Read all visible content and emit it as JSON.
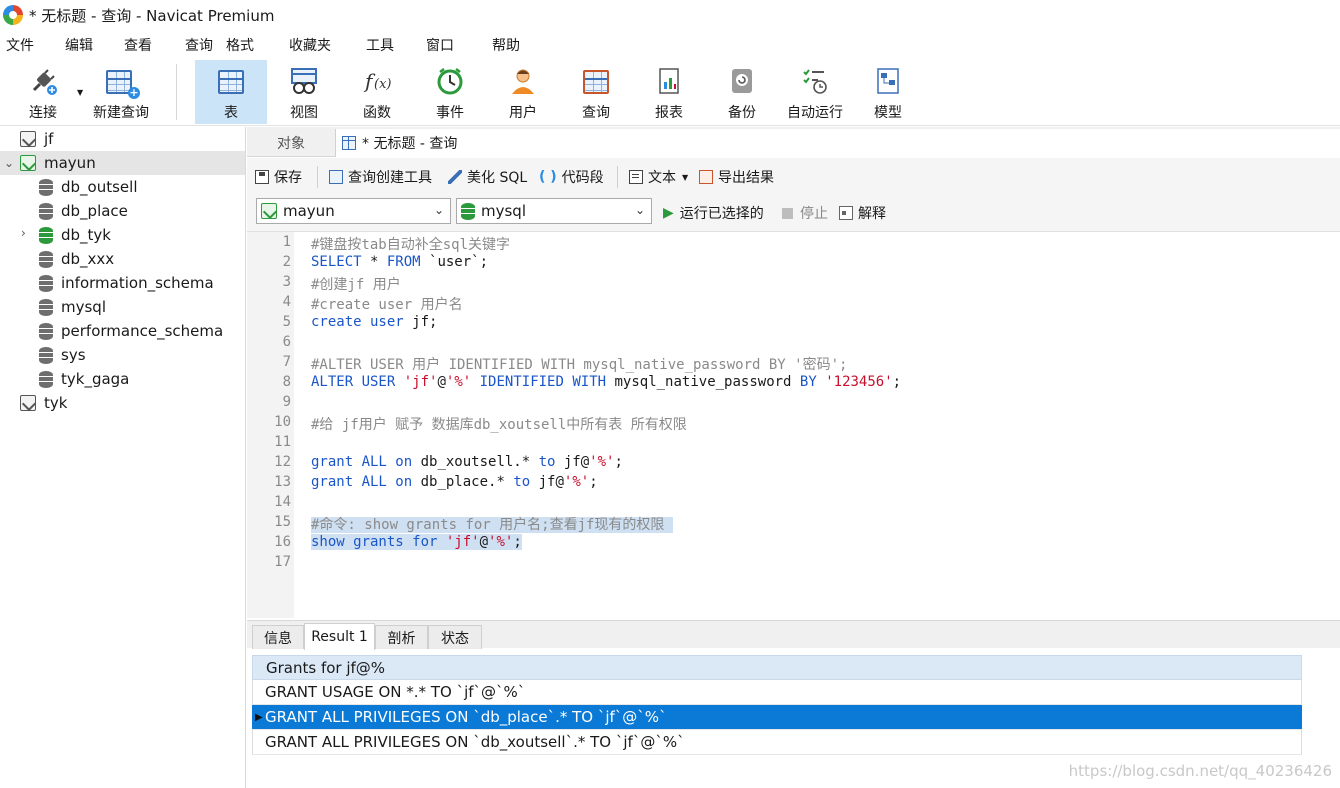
{
  "window": {
    "title": "* 无标题 - 查询 - Navicat Premium"
  },
  "menu": [
    "文件",
    "编辑",
    "查看",
    "查询",
    "格式",
    "收藏夹",
    "工具",
    "窗口",
    "帮助"
  ],
  "toolbar": {
    "connect": "连接",
    "new_query": "新建查询",
    "table": "表",
    "view": "视图",
    "function": "函数",
    "event": "事件",
    "user": "用户",
    "query": "查询",
    "report": "报表",
    "backup": "备份",
    "autorun": "自动运行",
    "model": "模型"
  },
  "sidebar": {
    "connections": [
      {
        "label": "jf"
      },
      {
        "label": "mayun"
      },
      {
        "label": "tyk"
      }
    ],
    "databases": [
      "db_outsell",
      "db_place",
      "db_tyk",
      "db_xxx",
      "information_schema",
      "mysql",
      "performance_schema",
      "sys",
      "tyk_gaga"
    ]
  },
  "tabs": {
    "objects": "对象",
    "query": "* 无标题 - 查询"
  },
  "query_toolbar": {
    "save": "保存",
    "builder": "查询创建工具",
    "beautify": "美化 SQL",
    "snippet": "代码段",
    "text": "文本",
    "export": "导出结果"
  },
  "selectors": {
    "connection": "mayun",
    "database": "mysql",
    "run_selected": "运行已选择的",
    "stop": "停止",
    "explain": "解释"
  },
  "editor": {
    "line_numbers": [
      "1",
      "2",
      "3",
      "4",
      "5",
      "6",
      "7",
      "8",
      "9",
      "10",
      "11",
      "12",
      "13",
      "14",
      "15",
      "16",
      "17"
    ],
    "lines": {
      "l1": "#键盘按tab自动补全sql关键字",
      "l2_kw1": "SELECT",
      "l2_rest1": " * ",
      "l2_kw2": "FROM",
      "l2_rest2": " `user`;",
      "l3": "#创建jf 用户",
      "l4": "#create user 用户名",
      "l5_kw": "create user",
      "l5_rest": " jf;",
      "l7": "#ALTER USER 用户 IDENTIFIED WITH mysql_native_password BY '密码';",
      "l8_kw1": "ALTER USER",
      "l8_s1": " 'jf'",
      "l8_at": "@",
      "l8_s2": "'%'",
      "l8_kw2": " IDENTIFIED WITH",
      "l8_plain": " mysql_native_password ",
      "l8_kw3": "BY",
      "l8_s3": " '123456'",
      "l8_end": ";",
      "l10": "#给 jf用户 赋予 数据库db_xoutsell中所有表 所有权限",
      "l12_kw1": "grant ALL on",
      "l12_plain": " db_xoutsell.* ",
      "l12_kw2": "to",
      "l12_plain2": " jf@",
      "l12_s": "'%'",
      "l12_end": ";",
      "l13_kw1": "grant ALL on",
      "l13_plain": " db_place.* ",
      "l13_kw2": "to",
      "l13_plain2": " jf@",
      "l13_s": "'%'",
      "l13_end": ";",
      "l15": "#命令: show grants for 用户名;查看jf现有的权限 ",
      "l16_kw": "show grants for",
      "l16_s1": " 'jf'",
      "l16_at": "@",
      "l16_s2": "'%'",
      "l16_end": ";"
    }
  },
  "result_tabs": [
    "信息",
    "Result 1",
    "剖析",
    "状态"
  ],
  "result": {
    "columns": [
      "Grants for jf@%"
    ],
    "rows": [
      "GRANT USAGE ON *.* TO `jf`@`%`",
      "GRANT ALL PRIVILEGES ON `db_place`.* TO `jf`@`%`",
      "GRANT ALL PRIVILEGES ON `db_xoutsell`.* TO `jf`@`%`"
    ],
    "selected_row": 1
  },
  "watermark": "https://blog.csdn.net/qq_40236426",
  "colors": {
    "accent": "#0a7ad6",
    "keyword": "#1a56c9",
    "string": "#c8102e",
    "comment": "#8a8a8a"
  }
}
